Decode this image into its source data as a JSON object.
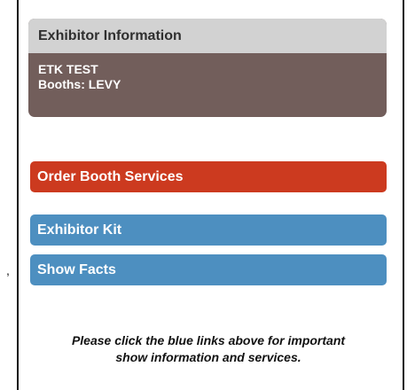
{
  "exhibitor_card": {
    "header": "Exhibitor Information",
    "name": "ETK TEST",
    "booths": "Booths: LEVY"
  },
  "links": {
    "order_booth_services": "Order Booth Services",
    "exhibitor_kit": "Exhibitor Kit",
    "show_facts": "Show Facts"
  },
  "note": {
    "line1": "Please click the blue links above for important",
    "line2": "show information and services."
  },
  "stray_mark": ",",
  "colors": {
    "card_header_bg": "#d2d2d2",
    "card_body_bg": "#725e5b",
    "order_button": "#cc3a1f",
    "blue_link": "#4d8fc0"
  }
}
